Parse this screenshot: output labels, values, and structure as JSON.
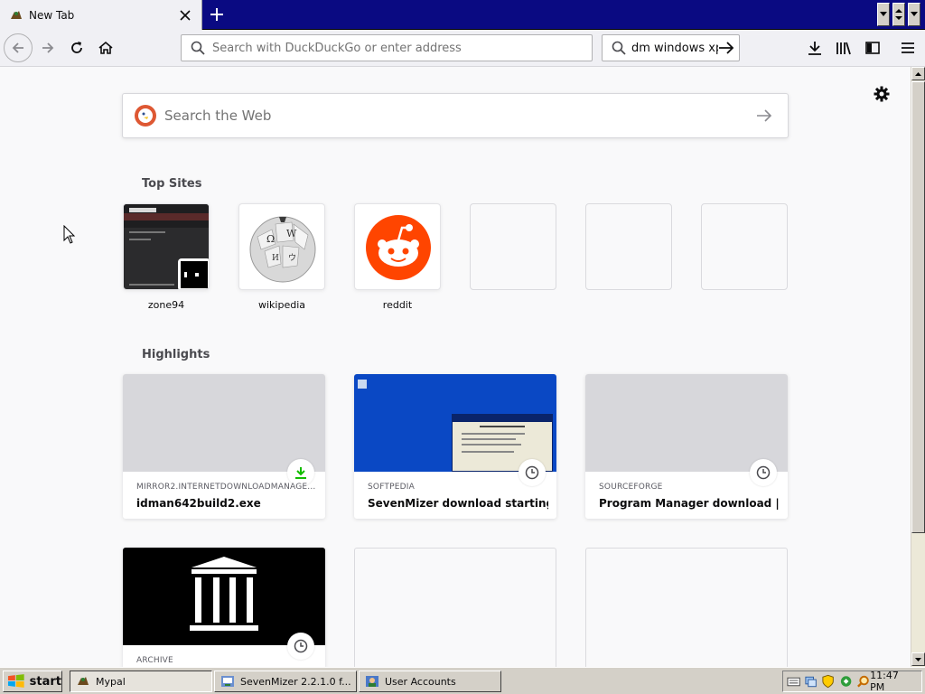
{
  "browser": {
    "tab": {
      "title": "New Tab"
    },
    "nav": {
      "url_placeholder": "Search with DuckDuckGo or enter address",
      "search_value": "dm windows xp"
    }
  },
  "newtab": {
    "websearch_placeholder": "Search the Web",
    "top_sites_title": "Top Sites",
    "highlights_title": "Highlights",
    "top_sites": [
      {
        "label": "zone94"
      },
      {
        "label": "wikipedia"
      },
      {
        "label": "reddit"
      }
    ],
    "highlights": [
      {
        "host": "MIRROR2.INTERNETDOWNLOADMANAGE...",
        "title": "idman642build2.exe",
        "badge": "download-icon"
      },
      {
        "host": "SOFTPEDIA",
        "title": "SevenMizer download starting...",
        "badge": "clock-icon"
      },
      {
        "host": "SOURCEFORGE",
        "title": "Program Manager download | So...",
        "badge": "clock-icon"
      },
      {
        "host": "ARCHIVE",
        "title": "",
        "badge": "clock-icon"
      }
    ]
  },
  "taskbar": {
    "start_label": "start",
    "items": [
      {
        "label": "Mypal"
      },
      {
        "label": "SevenMizer 2.2.1.0 f..."
      },
      {
        "label": "User Accounts"
      }
    ],
    "clock": "11:47 PM"
  },
  "colors": {
    "tabstrip": "#0a0a82",
    "reddit": "#ff4500",
    "download_green": "#12bc00",
    "xp_desktop_blue": "#0a48c4"
  }
}
